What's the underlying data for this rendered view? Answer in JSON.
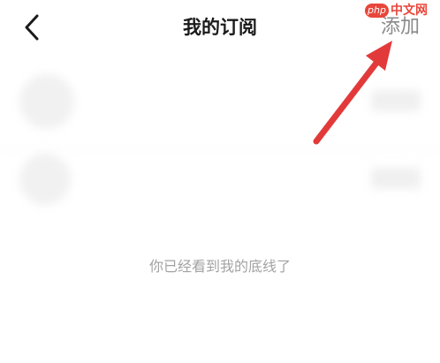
{
  "header": {
    "title": "我的订阅",
    "add_label": "添加",
    "back_icon": "chevron-left-icon"
  },
  "watermark": {
    "badge_text": "php",
    "site_text": "中文网",
    "color": "#e8463a"
  },
  "subscriptions": {
    "items": [
      {
        "name": "",
        "desc": ""
      },
      {
        "name": "",
        "desc": ""
      }
    ]
  },
  "footer": {
    "end_text": "你已经看到我的底线了"
  },
  "annotation": {
    "arrow_color": "#e23a3a",
    "points_to": "add-button"
  }
}
